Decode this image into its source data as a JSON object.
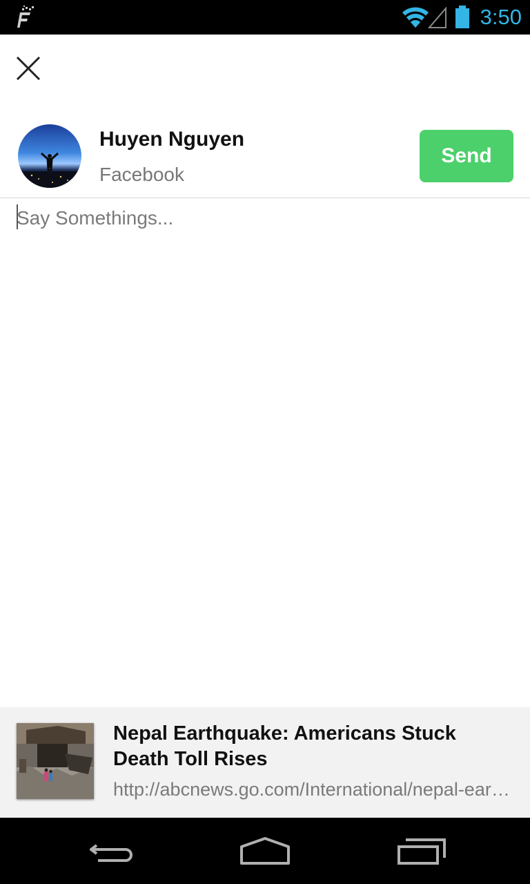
{
  "status_bar": {
    "time": "3:50",
    "icons": [
      "app-notification-icon",
      "wifi-icon",
      "cell-signal-icon",
      "battery-icon"
    ],
    "accent_color": "#33b5e5"
  },
  "composer": {
    "close_icon": "close-icon",
    "account": {
      "name": "Huyen Nguyen",
      "network": "Facebook"
    },
    "send_label": "Send",
    "send_color": "#4cd06b",
    "placeholder": "Say Somethings..."
  },
  "link_preview": {
    "title": "Nepal Earthquake: Americans Stuck Death Toll Rises",
    "url": "http://abcnews.go.com/International/nepal-earthquake-americans-stuck-death-toll-rises"
  },
  "nav_bar": {
    "icons": [
      "back-icon",
      "home-icon",
      "recents-icon"
    ]
  }
}
